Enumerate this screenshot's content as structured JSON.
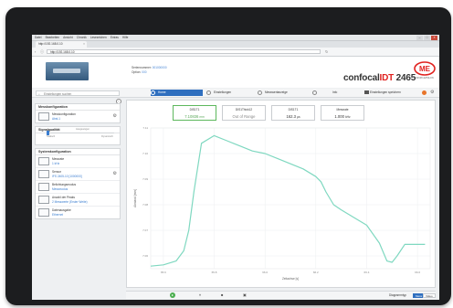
{
  "browser": {
    "menu": [
      "Datei",
      "Bearbeiten",
      "Ansicht",
      "Chronik",
      "Lesezeichen",
      "Extras",
      "Hilfe"
    ],
    "tab_title": "http://192.168.0.10",
    "url": "http://192.168.0.10"
  },
  "header": {
    "serial_label": "Seriennummer:",
    "serial_value": "001000000",
    "option_label": "Option:",
    "option_value": "000",
    "product_prefix": "confocal",
    "product_idt": "IDT",
    "product_model": " 2465",
    "logo_text": "MICRO-EPSILON",
    "brand_color": "#e0221f"
  },
  "toolbar": {
    "search_placeholder": "Einstellungen suchen",
    "tabs": [
      "Home",
      "Einstellungen",
      "Messwertanzeige",
      "Info"
    ],
    "save_label": "Einstellungen speichern",
    "accent": "#2f6fbf"
  },
  "sidebar": {
    "measure_config": {
      "title": "Messkonfiguration",
      "item_label": "Messkonfiguration",
      "item_value": "Abst.1"
    },
    "signal_quality": {
      "title": "Signalqualität",
      "mid_label": "Ausgewogen",
      "left_label": "Statisch",
      "right_label": "Dynamisch"
    },
    "system_config": {
      "title": "Systemkonfiguration",
      "items": [
        {
          "label": "Messrate",
          "value": "1 kHz"
        },
        {
          "label": "Sensor",
          "value": "IFS 2405-10 [1000000]"
        },
        {
          "label": "Belichtungsmodus",
          "value": "Messmodus"
        },
        {
          "label": "Anzahl der Peaks",
          "value": "2 Messwerte (Erster Weite)"
        },
        {
          "label": "Datenausgabe",
          "value": "Ethernet"
        }
      ]
    }
  },
  "measurements": [
    {
      "name": "DIS1T1",
      "value": "7.10836",
      "unit": "mm",
      "state": "ok"
    },
    {
      "name": "DIS1Thick12",
      "value": "Out of Range",
      "unit": "",
      "state": "oor"
    },
    {
      "name": "DIS1T1",
      "value": "162.3",
      "unit": "µs",
      "state": "neutral"
    },
    {
      "name": "Messrate",
      "value": "1.000",
      "unit": "kHz",
      "state": "neutral"
    }
  ],
  "chart_data": {
    "type": "line",
    "xlabel": "Zeitachse [s]",
    "ylabel": "Abstand [mm]",
    "xticks": [
      "65.6",
      "65.8",
      "66.0",
      "66.2",
      "66.4",
      "66.6"
    ],
    "yticks": [
      "7.11",
      "7.10",
      "7.09",
      "7.08",
      "7.07",
      "7.06"
    ],
    "xlim": [
      65.55,
      66.65
    ],
    "ylim": [
      7.055,
      7.11
    ],
    "grid": true,
    "series": [
      {
        "color": "#7fd8c0",
        "x": [
          65.55,
          65.6,
          65.65,
          65.68,
          65.7,
          65.72,
          65.75,
          65.8,
          65.85,
          65.9,
          65.95,
          66.0,
          66.05,
          66.1,
          66.15,
          66.2,
          66.22,
          66.24,
          66.27,
          66.3,
          66.35,
          66.4,
          66.45,
          66.48,
          66.5,
          66.52,
          66.55,
          66.6,
          66.63
        ],
        "y": [
          7.056,
          7.0565,
          7.058,
          7.062,
          7.07,
          7.085,
          7.104,
          7.107,
          7.105,
          7.103,
          7.101,
          7.1,
          7.098,
          7.096,
          7.094,
          7.091,
          7.089,
          7.085,
          7.08,
          7.078,
          7.075,
          7.072,
          7.065,
          7.058,
          7.0575,
          7.06,
          7.0645,
          7.0645,
          7.0645
        ]
      }
    ]
  },
  "bottombar": {
    "legend_label": "Diagrammtyp",
    "toggle_a": "Mess",
    "toggle_b": "Video"
  }
}
